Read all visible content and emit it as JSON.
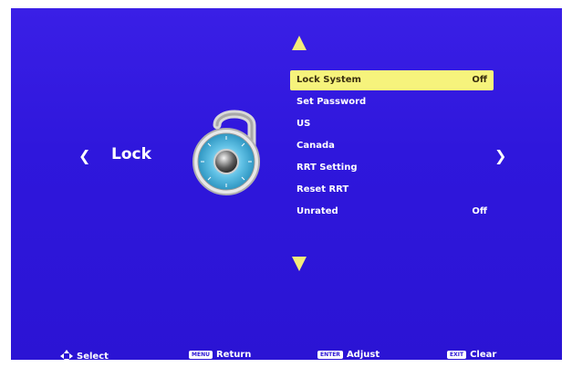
{
  "page": {
    "title": "Lock"
  },
  "nav": {
    "left_arrow": "❮",
    "right_arrow": "❯"
  },
  "menu": {
    "items": [
      {
        "label": "Lock System",
        "value": "Off"
      },
      {
        "label": "Set Password",
        "value": ""
      },
      {
        "label": "US",
        "value": ""
      },
      {
        "label": "Canada",
        "value": ""
      },
      {
        "label": "RRT Setting",
        "value": ""
      },
      {
        "label": "Reset RRT",
        "value": ""
      },
      {
        "label": "Unrated",
        "value": "Off"
      }
    ]
  },
  "footer": {
    "select": {
      "label": "Select"
    },
    "return": {
      "key": "MENU",
      "label": "Return"
    },
    "adjust": {
      "key": "ENTER",
      "label": "Adjust"
    },
    "clear": {
      "key": "EXIT",
      "label": "Clear"
    }
  },
  "colors": {
    "background": "#2f17dc",
    "highlight": "#f6f37c",
    "arrow": "#f3ec7a"
  },
  "icons": [
    "lock-icon",
    "arrow-up-icon",
    "arrow-down-icon",
    "dpad-icon"
  ]
}
